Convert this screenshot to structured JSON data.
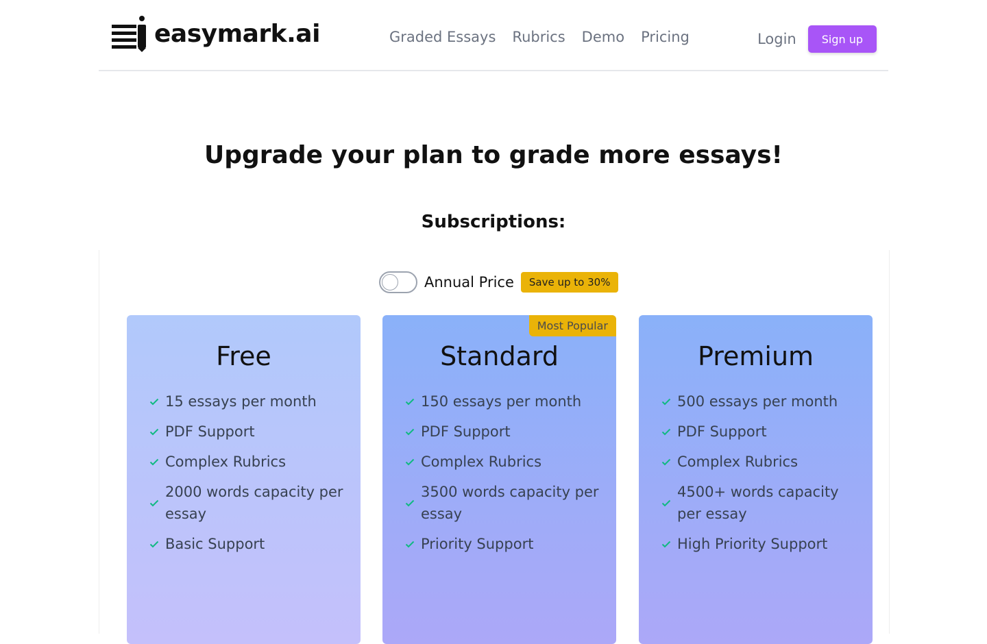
{
  "brand": {
    "name": "easymark.ai"
  },
  "nav": {
    "items": [
      "Graded Essays",
      "Rubrics",
      "Demo",
      "Pricing"
    ]
  },
  "auth": {
    "login": "Login",
    "signup": "Sign up"
  },
  "hero": {
    "headline": "Upgrade your plan to grade more essays!",
    "subtitle": "Subscriptions:"
  },
  "billing": {
    "toggle_label": "Annual Price",
    "annual_enabled": false,
    "save_badge": "Save up to 30%"
  },
  "plans": [
    {
      "name": "Free",
      "badge": "",
      "features": [
        "15 essays per month",
        "PDF Support",
        "Complex Rubrics",
        "2000 words capacity per essay",
        "Basic Support"
      ]
    },
    {
      "name": "Standard",
      "badge": "Most Popular",
      "features": [
        "150 essays per month",
        "PDF Support",
        "Complex Rubrics",
        "3500 words capacity per essay",
        "Priority Support"
      ]
    },
    {
      "name": "Premium",
      "badge": "",
      "features": [
        "500 essays per month",
        "PDF Support",
        "Complex Rubrics",
        "4500+ words capacity per essay",
        "High Priority Support"
      ]
    }
  ],
  "colors": {
    "accent": "#a855f7",
    "badge": "#eab308",
    "check": "#10b981"
  }
}
